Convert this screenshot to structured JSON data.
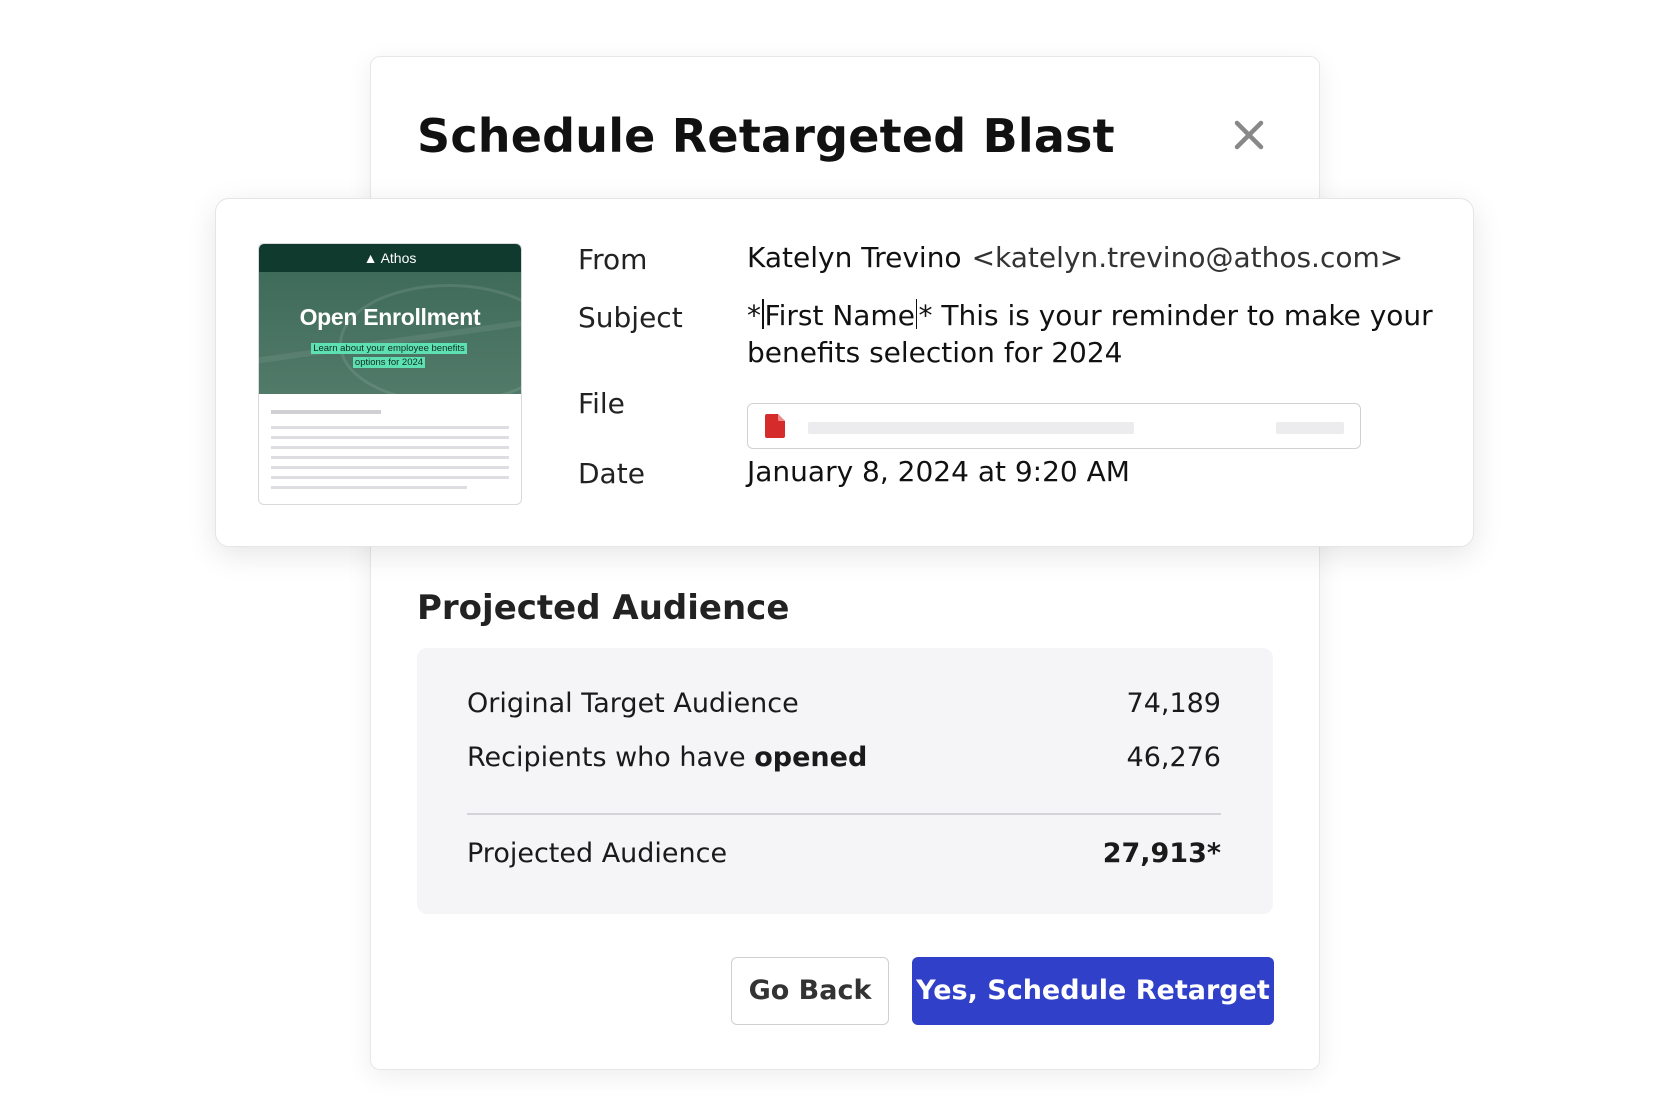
{
  "modal": {
    "title": "Schedule Retargeted Blast",
    "close_icon": "close-icon"
  },
  "email": {
    "thumbnail": {
      "brand": "Athos",
      "headline": "Open Enrollment",
      "tagline_line1": "Learn about your employee benefits",
      "tagline_line2": "options for 2024",
      "accent_color": "#5fe0b3",
      "header_color": "#0f3a2d"
    },
    "from_label": "From",
    "from_name": "Katelyn Trevino",
    "from_email": "<katelyn.trevino@athos.com>",
    "subject_label": "Subject",
    "subject_merge_prefix": "*",
    "subject_merge_field": "First Name",
    "subject_merge_suffix": "*",
    "subject_line1_rest": " This is your reminder to make your",
    "subject_line2": "benefits selection for 2024",
    "file_label": "File",
    "file_icon": "pdf-file-icon",
    "file_icon_color": "#d62b2b",
    "date_label": "Date",
    "date_value": "January 8, 2024 at 9:20 AM"
  },
  "audience": {
    "title": "Projected Audience",
    "rows": [
      {
        "label": "Original Target Audience",
        "value": "74,189"
      },
      {
        "label_prefix": "Recipients who have ",
        "label_bold": "opened",
        "value": "46,276"
      }
    ],
    "total_label": "Projected Audience",
    "total_value": "27,913*"
  },
  "actions": {
    "back_label": "Go Back",
    "confirm_label": "Yes, Schedule Retarget",
    "primary_color": "#3040c8"
  }
}
